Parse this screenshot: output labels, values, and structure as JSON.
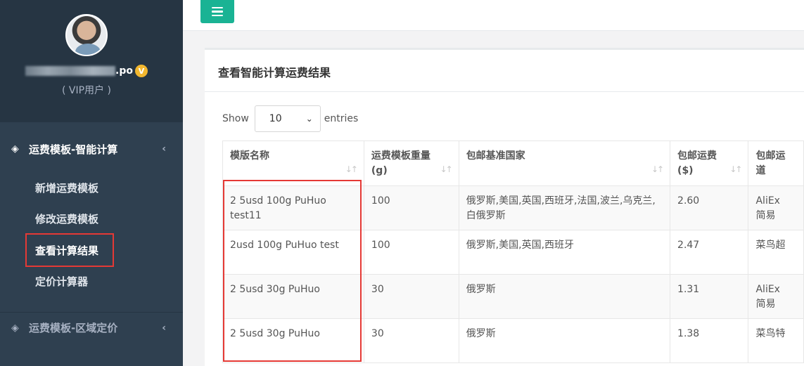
{
  "sidebar": {
    "username_suffix": ".po",
    "vip_badge": "V",
    "vip_label": "( VIP用户 )",
    "menu_groups": [
      {
        "label": "运费模板-智能计算",
        "icon": "diamond-icon",
        "expanded": true,
        "items": [
          {
            "label": "新增运费模板",
            "active": false
          },
          {
            "label": "修改运费模板",
            "active": false
          },
          {
            "label": "查看计算结果",
            "active": true
          },
          {
            "label": "定价计算器",
            "active": false
          }
        ]
      },
      {
        "label": "运费模板-区域定价",
        "icon": "diamond-icon",
        "expanded": false
      }
    ],
    "chevron": "‹"
  },
  "topbar": {
    "menu_toggle_icon": "hamburger-icon"
  },
  "panel": {
    "title": "查看智能计算运费结果",
    "length_control": {
      "prefix": "Show",
      "selected": "10",
      "suffix": "entries"
    }
  },
  "table": {
    "columns": [
      {
        "line1": "模版名称",
        "line2": ""
      },
      {
        "line1": "运费模板重量",
        "line2": "(g)"
      },
      {
        "line1": "包邮基准国家",
        "line2": ""
      },
      {
        "line1": "包邮运费",
        "line2": "($)"
      },
      {
        "line1": "包邮运",
        "line2": "道"
      }
    ],
    "sort_icon": "↓↑",
    "rows": [
      {
        "name": "2 5usd 100g PuHuo test11",
        "weight": "100",
        "countries": "俄罗斯,美国,英国,西班牙,法国,波兰,乌克兰,白俄罗斯",
        "fee": "2.60",
        "channel_1": "AliEx",
        "channel_2": "简易"
      },
      {
        "name": "2usd 100g PuHuo test",
        "weight": "100",
        "countries": "俄罗斯,美国,英国,西班牙",
        "fee": "2.47",
        "channel_1": "菜鸟超",
        "channel_2": ""
      },
      {
        "name": "2 5usd 30g PuHuo",
        "weight": "30",
        "countries": "俄罗斯",
        "fee": "1.31",
        "channel_1": "AliEx",
        "channel_2": "简易"
      },
      {
        "name": "2 5usd 30g PuHuo",
        "weight": "30",
        "countries": "俄罗斯",
        "fee": "1.38",
        "channel_1": "菜鸟特",
        "channel_2": ""
      }
    ]
  },
  "colors": {
    "sidebar_bg": "#2f4050",
    "accent": "#1ab394",
    "highlight_box": "#e53935",
    "vip_badge": "#f2b72f"
  }
}
